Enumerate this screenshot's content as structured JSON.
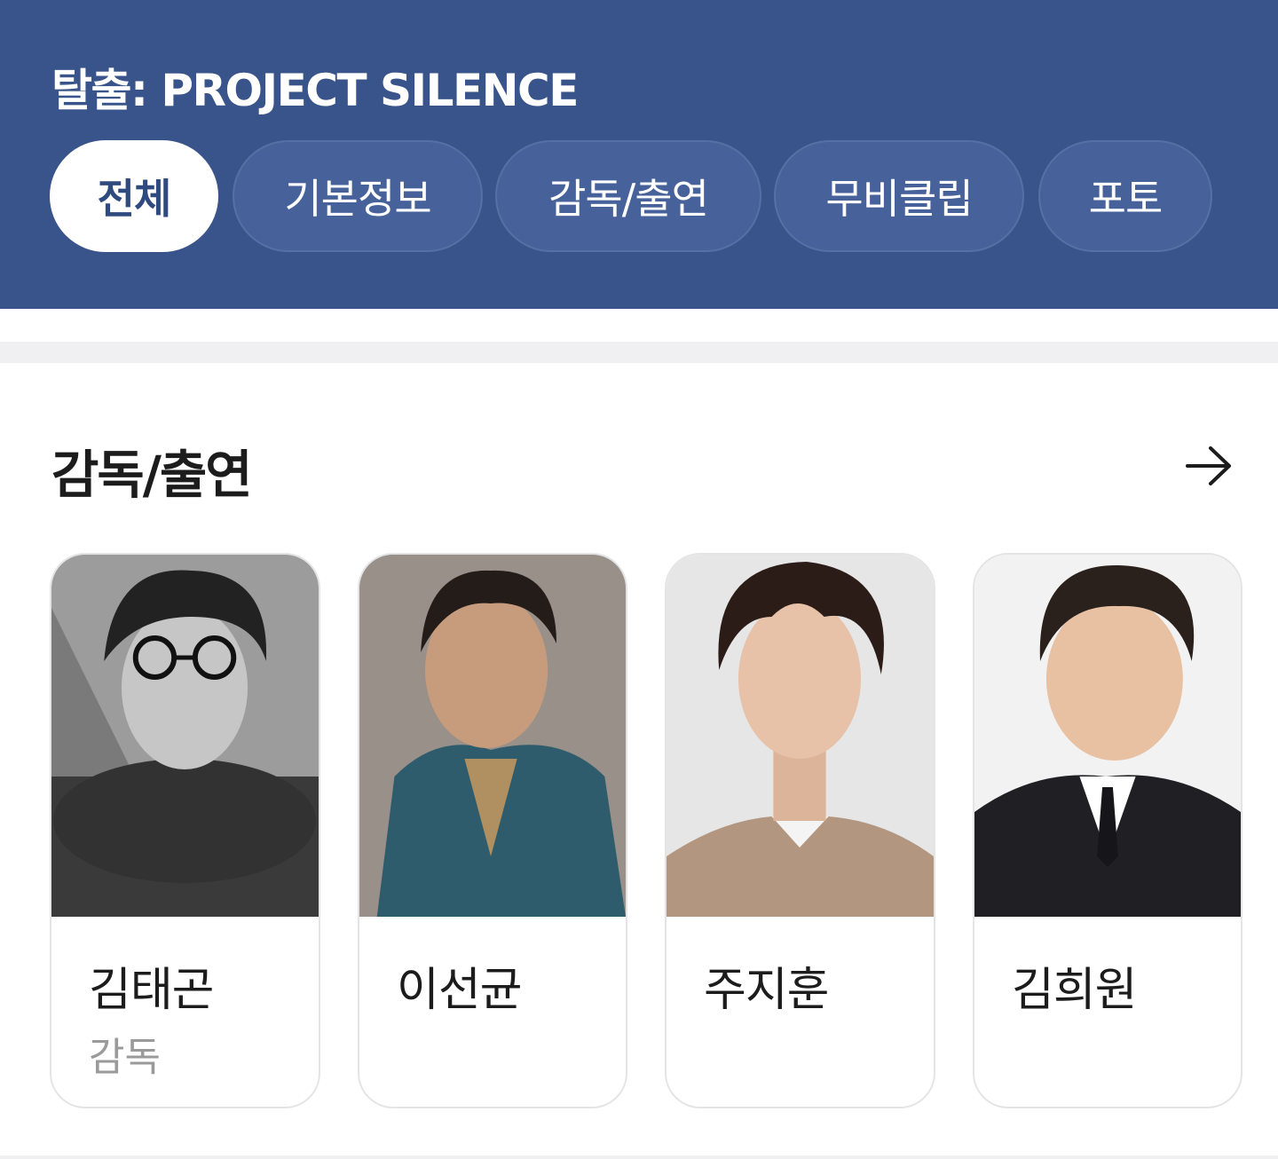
{
  "header": {
    "title": "탈출: PROJECT SILENCE",
    "tabs": [
      {
        "label": "전체",
        "active": true
      },
      {
        "label": "기본정보",
        "active": false
      },
      {
        "label": "감독/출연",
        "active": false
      },
      {
        "label": "무비클립",
        "active": false
      },
      {
        "label": "포토",
        "active": false
      }
    ]
  },
  "cast_section": {
    "title": "감독/출연",
    "more_icon": "arrow-right-icon",
    "people": [
      {
        "name": "김태곤",
        "role": "감독"
      },
      {
        "name": "이선균",
        "role": ""
      },
      {
        "name": "주지훈",
        "role": ""
      },
      {
        "name": "김희원",
        "role": ""
      }
    ]
  },
  "colors": {
    "header_bg": "#39548a",
    "tab_bg": "#47629a",
    "active_tab_text": "#2f4a7e"
  }
}
